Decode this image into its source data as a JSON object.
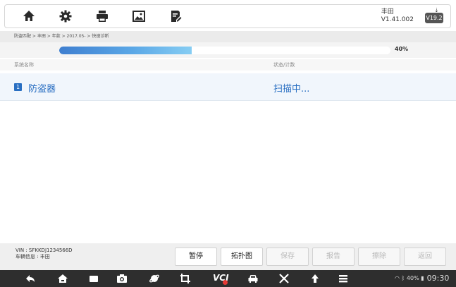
{
  "toolbar": {
    "buttons": [
      "home-icon",
      "settings-icon",
      "print-icon",
      "image-icon",
      "edit-report-icon"
    ],
    "vehicle_make": "丰田",
    "version": "V1.41.002",
    "update_badge": "V19.2"
  },
  "breadcrumb": "防盗匹配 > 丰田 > 年款 > 2017.05- > 快速诊断",
  "progress": {
    "percent": 40,
    "label": "40%"
  },
  "columns": {
    "system_name": "系统名称",
    "status": "状态/计数"
  },
  "systems": [
    {
      "index": "1",
      "name": "防盗器",
      "status": "扫描中..."
    }
  ],
  "footer": {
    "vin": "VIN : SFKKDJ1234566D",
    "vehicle_info": "车辆信息 : 丰田",
    "buttons": [
      {
        "label": "暂停",
        "enabled": true
      },
      {
        "label": "拓扑图",
        "enabled": true
      },
      {
        "label": "保存",
        "enabled": false
      },
      {
        "label": "报告",
        "enabled": false
      },
      {
        "label": "擦除",
        "enabled": false
      },
      {
        "label": "返回",
        "enabled": false
      }
    ]
  },
  "navbar": {
    "vci_label": "VCI",
    "battery": "40%",
    "time": "09:30"
  },
  "colors": {
    "accent": "#2a6fc2",
    "progress": "#5aa7e6",
    "navbar": "#2e2e2e"
  }
}
